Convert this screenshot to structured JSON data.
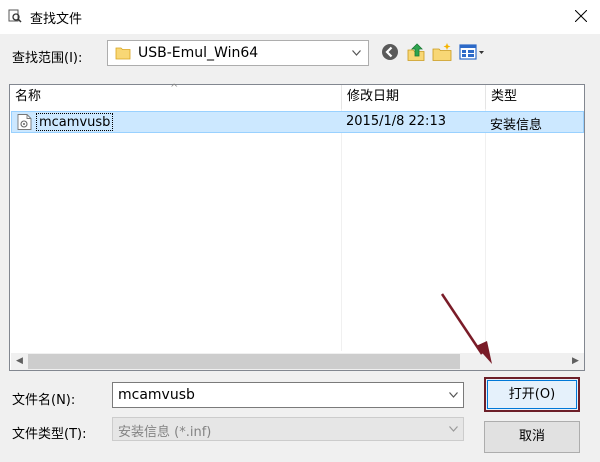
{
  "window": {
    "title": "查找文件"
  },
  "lookin": {
    "label": "查找范围(I):",
    "value": "USB-Emul_Win64"
  },
  "toolbar": {
    "back_icon": "back-arrow-icon",
    "up_icon": "up-folder-icon",
    "newfolder_icon": "new-folder-icon",
    "view_icon": "view-menu-icon"
  },
  "filelist": {
    "columns": [
      "名称",
      "修改日期",
      "类型"
    ],
    "rows": [
      {
        "name": "mcamvusb",
        "date": "2015/1/8 22:13",
        "type": "安装信息",
        "selected": true
      }
    ]
  },
  "filename": {
    "label": "文件名(N):",
    "value": "mcamvusb"
  },
  "filetype": {
    "label": "文件类型(T):",
    "value": "安装信息 (*.inf)"
  },
  "buttons": {
    "open": "打开(O)",
    "cancel": "取消"
  },
  "colors": {
    "selection": "#cce8ff",
    "selection_border": "#99d1ff",
    "annotation": "#7a1c28"
  }
}
